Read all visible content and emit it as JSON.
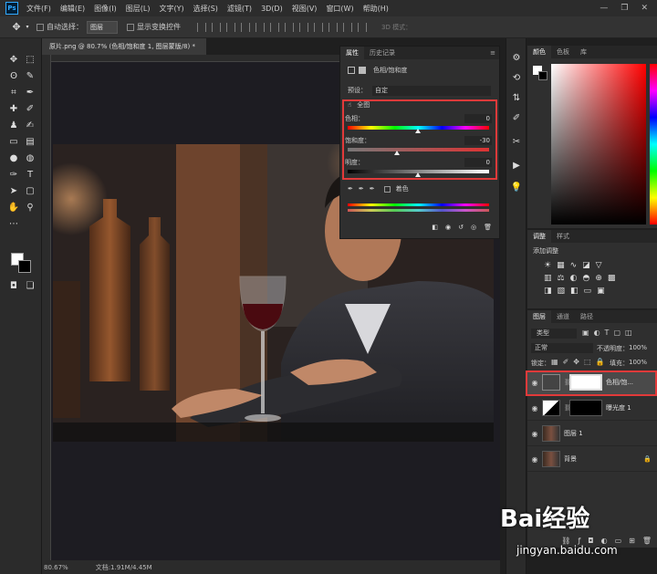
{
  "menu": [
    "文件(F)",
    "编辑(E)",
    "图像(I)",
    "图层(L)",
    "文字(Y)",
    "选择(S)",
    "滤镜(T)",
    "3D(D)",
    "视图(V)",
    "窗口(W)",
    "帮助(H)"
  ],
  "options": {
    "auto_select": "自动选择：",
    "target": "图层",
    "show_transform": "显示变换控件",
    "mode_3d": "3D 模式："
  },
  "document": {
    "tab": "原片.png @ 80.7% (色相/饱和度 1, 图层蒙版/8) *",
    "zoom": "80.67%",
    "doc_size": "文档:1.91M/4.45M"
  },
  "properties": {
    "tabs": [
      "属性",
      "历史记录"
    ],
    "title": "色相/饱和度",
    "preset_label": "预设：",
    "preset_value": "自定",
    "channel": "全图",
    "hue_label": "色相：",
    "hue": "0",
    "saturation_label": "饱和度：",
    "saturation": "-30",
    "lightness_label": "明度：",
    "lightness": "0",
    "colorize": "着色"
  },
  "color_panel": {
    "tabs": [
      "颜色",
      "色板",
      "库"
    ]
  },
  "adjustments_panel": {
    "tabs": [
      "调整",
      "样式"
    ],
    "title": "添加调整"
  },
  "layers_panel": {
    "tabs": [
      "图层",
      "通道",
      "路径"
    ],
    "filter": "类型",
    "blend_mode": "正常",
    "opacity_label": "不透明度：",
    "opacity": "100%",
    "lock_label": "锁定：",
    "fill_label": "填充：",
    "fill": "100%",
    "layers": [
      {
        "name": "色相/饱...",
        "type": "adjustment",
        "selected": true
      },
      {
        "name": "曝光度 1",
        "type": "adjustment",
        "selected": false
      },
      {
        "name": "图层 1",
        "type": "pixel",
        "selected": false
      },
      {
        "name": "背景",
        "type": "pixel",
        "selected": false
      }
    ]
  },
  "watermark": {
    "logo": "Bai经验",
    "url": "jingyan.baidu.com"
  },
  "colors": {
    "highlight": "#e23a3a",
    "accent": "#31a8ff"
  }
}
